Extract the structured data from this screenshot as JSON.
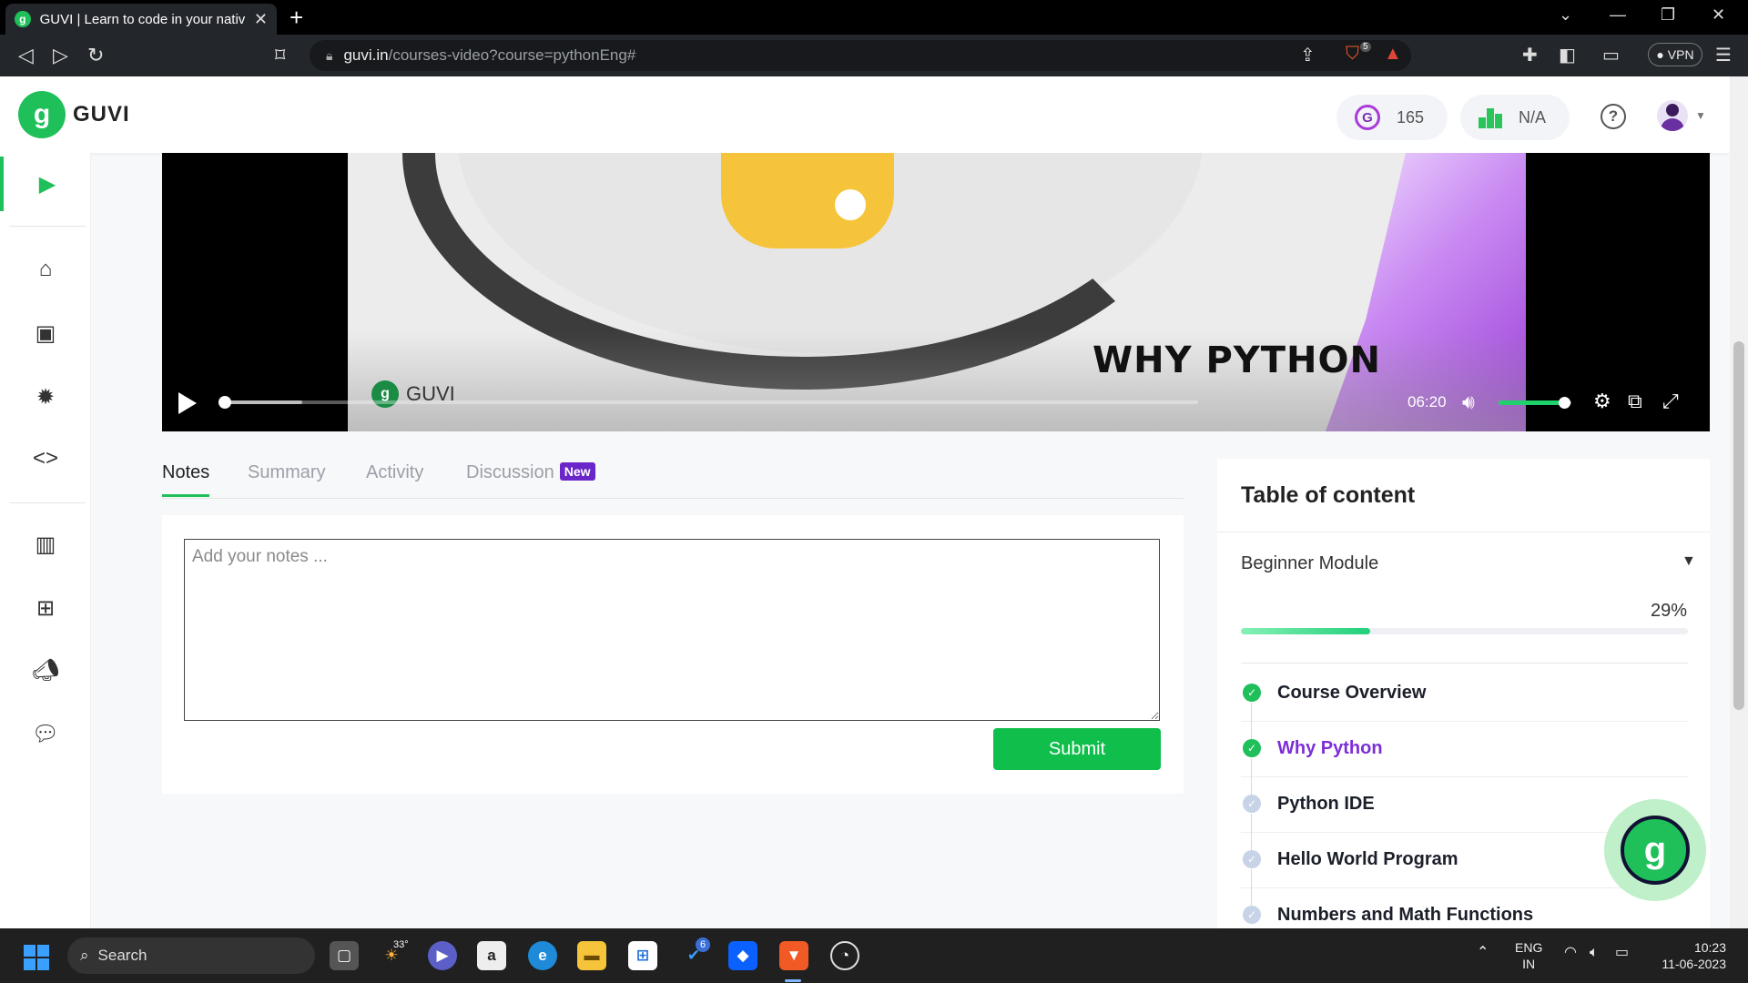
{
  "browser": {
    "tab_title": "GUVI | Learn to code in your nativ",
    "tab_close": "✕",
    "new_tab": "+",
    "url_host": "guvi.in",
    "url_path": "/courses-video?course=pythonEng#",
    "vpn_label": "● VPN",
    "shield_count": "5"
  },
  "header": {
    "logo_mark": "g",
    "brand": "GUVI",
    "gems": "165",
    "rank": "N/A",
    "help": "?"
  },
  "video": {
    "heading": "WHY PYTHON",
    "watermark": "GUVI",
    "time": "06:20",
    "progress_fraction": 0.0,
    "buffered_fraction": 0.08,
    "volume_fraction": 0.9
  },
  "tabs": {
    "notes": "Notes",
    "summary": "Summary",
    "activity": "Activity",
    "discussion": "Discussion",
    "new_badge": "New"
  },
  "notes": {
    "placeholder": "Add your notes ...",
    "submit": "Submit"
  },
  "toc": {
    "title": "Table of content",
    "module": "Beginner Module",
    "progress_label": "29%",
    "progress_fraction": 0.29,
    "lessons": [
      {
        "label": "Course Overview",
        "status": "done"
      },
      {
        "label": "Why Python",
        "status": "current"
      },
      {
        "label": "Python IDE",
        "status": "todo"
      },
      {
        "label": "Hello World Program",
        "status": "todo"
      },
      {
        "label": "Numbers and Math Functions",
        "status": "todo"
      }
    ]
  },
  "taskbar": {
    "search": "Search",
    "weather": "33°",
    "lang_top": "ENG",
    "lang_bottom": "IN",
    "time": "10:23",
    "date": "11-06-2023",
    "steam_badge": "6"
  },
  "colors": {
    "brand_green": "#1fbf5a",
    "accent_purple": "#7c2fd8",
    "submit_green": "#0fbe4b"
  }
}
